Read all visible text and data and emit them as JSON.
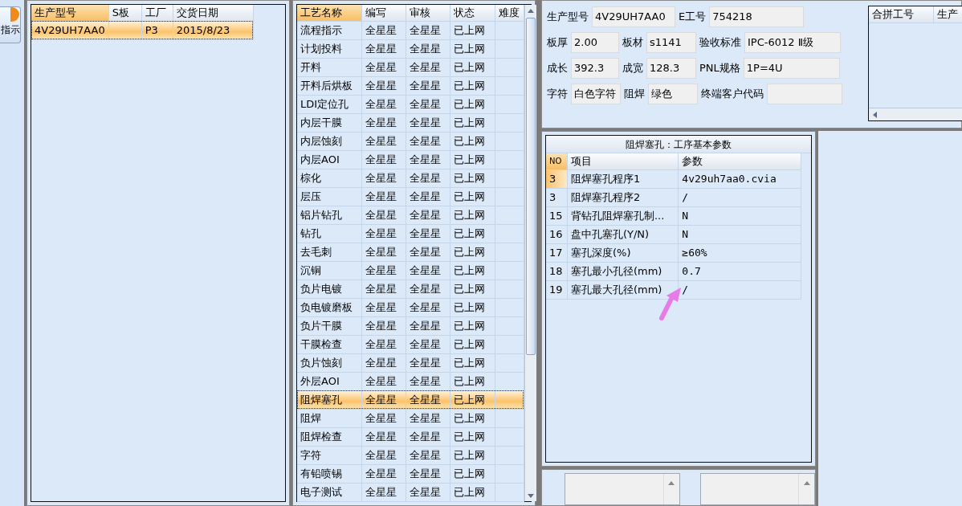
{
  "side_button": {
    "label": "指示"
  },
  "order_table": {
    "columns": [
      "生产型号",
      "S板",
      "工厂",
      "交货日期"
    ],
    "rows": [
      {
        "cells": [
          "4V29UH7AA0",
          "",
          "P3",
          "2015/8/23"
        ],
        "selected": true
      }
    ]
  },
  "process_table": {
    "columns": [
      "工艺名称",
      "编写",
      "审核",
      "状态",
      "难度"
    ],
    "rows": [
      {
        "name": "流程指示",
        "writer": "全星星",
        "reviewer": "全星星",
        "status": "已上网",
        "selected": false
      },
      {
        "name": "计划投料",
        "writer": "全星星",
        "reviewer": "全星星",
        "status": "已上网",
        "selected": false
      },
      {
        "name": "开料",
        "writer": "全星星",
        "reviewer": "全星星",
        "status": "已上网",
        "selected": false
      },
      {
        "name": "开料后烘板",
        "writer": "全星星",
        "reviewer": "全星星",
        "status": "已上网",
        "selected": false
      },
      {
        "name": "LDI定位孔",
        "writer": "全星星",
        "reviewer": "全星星",
        "status": "已上网",
        "selected": false
      },
      {
        "name": "内层干膜",
        "writer": "全星星",
        "reviewer": "全星星",
        "status": "已上网",
        "selected": false
      },
      {
        "name": "内层蚀刻",
        "writer": "全星星",
        "reviewer": "全星星",
        "status": "已上网",
        "selected": false
      },
      {
        "name": "内层AOI",
        "writer": "全星星",
        "reviewer": "全星星",
        "status": "已上网",
        "selected": false
      },
      {
        "name": "棕化",
        "writer": "全星星",
        "reviewer": "全星星",
        "status": "已上网",
        "selected": false
      },
      {
        "name": "层压",
        "writer": "全星星",
        "reviewer": "全星星",
        "status": "已上网",
        "selected": false
      },
      {
        "name": "铝片钻孔",
        "writer": "全星星",
        "reviewer": "全星星",
        "status": "已上网",
        "selected": false
      },
      {
        "name": "钻孔",
        "writer": "全星星",
        "reviewer": "全星星",
        "status": "已上网",
        "selected": false
      },
      {
        "name": "去毛刺",
        "writer": "全星星",
        "reviewer": "全星星",
        "status": "已上网",
        "selected": false
      },
      {
        "name": "沉铜",
        "writer": "全星星",
        "reviewer": "全星星",
        "status": "已上网",
        "selected": false
      },
      {
        "name": "负片电镀",
        "writer": "全星星",
        "reviewer": "全星星",
        "status": "已上网",
        "selected": false
      },
      {
        "name": "负电镀磨板",
        "writer": "全星星",
        "reviewer": "全星星",
        "status": "已上网",
        "selected": false
      },
      {
        "name": "负片干膜",
        "writer": "全星星",
        "reviewer": "全星星",
        "status": "已上网",
        "selected": false
      },
      {
        "name": "干膜检查",
        "writer": "全星星",
        "reviewer": "全星星",
        "status": "已上网",
        "selected": false
      },
      {
        "name": "负片蚀刻",
        "writer": "全星星",
        "reviewer": "全星星",
        "status": "已上网",
        "selected": false
      },
      {
        "name": "外层AOI",
        "writer": "全星星",
        "reviewer": "全星星",
        "status": "已上网",
        "selected": false
      },
      {
        "name": "阻焊塞孔",
        "writer": "全星星",
        "reviewer": "全星星",
        "status": "已上网",
        "selected": true
      },
      {
        "name": "阻焊",
        "writer": "全星星",
        "reviewer": "全星星",
        "status": "已上网",
        "selected": false
      },
      {
        "name": "阻焊检查",
        "writer": "全星星",
        "reviewer": "全星星",
        "status": "已上网",
        "selected": false
      },
      {
        "name": "字符",
        "writer": "全星星",
        "reviewer": "全星星",
        "status": "已上网",
        "selected": false
      },
      {
        "name": "有铅喷锡",
        "writer": "全星星",
        "reviewer": "全星星",
        "status": "已上网",
        "selected": false
      },
      {
        "name": "电子测试",
        "writer": "全星星",
        "reviewer": "全星星",
        "status": "已上网",
        "selected": false
      }
    ]
  },
  "info_form": {
    "rows": [
      [
        {
          "label": "生产型号",
          "value": "4V29UH7AA0"
        },
        null,
        {
          "label": "E工号",
          "value": "754218"
        }
      ],
      [
        {
          "label": "板厚",
          "value": "2.00"
        },
        {
          "label": "板材",
          "value": "s1141"
        },
        {
          "label": "验收标准",
          "value": "IPC-6012 Ⅱ级"
        }
      ],
      [
        {
          "label": "成长",
          "value": "392.3"
        },
        {
          "label": "成宽",
          "value": "128.3"
        },
        {
          "label": "PNL规格",
          "value": "1P=4U"
        }
      ],
      [
        {
          "label": "字符",
          "value": "白色字符"
        },
        {
          "label": "阻焊",
          "value": "绿色"
        },
        {
          "label": "终端客户代码"
        }
      ]
    ]
  },
  "merge_table": {
    "columns": [
      "合拼工号",
      "生产"
    ]
  },
  "param_panel": {
    "title": "阻焊塞孔：工序基本参数",
    "columns": [
      "NO",
      "项目",
      "参数"
    ],
    "rows": [
      {
        "no": "3",
        "item": "阻焊塞孔程序1",
        "value": "4v29uh7aa0.cvia",
        "selected": true
      },
      {
        "no": "3",
        "item": "阻焊塞孔程序2",
        "value": "/",
        "selected": false
      },
      {
        "no": "15",
        "item": "背钻孔阻焊塞孔制...",
        "value": "N",
        "selected": false
      },
      {
        "no": "16",
        "item": "盘中孔塞孔(Y/N)",
        "value": "N",
        "selected": false
      },
      {
        "no": "17",
        "item": "塞孔深度(%)",
        "value": "≥60%",
        "selected": false
      },
      {
        "no": "18",
        "item": "塞孔最小孔径(mm)",
        "value": "0.7",
        "selected": false
      },
      {
        "no": "19",
        "item": "塞孔最大孔径(mm)",
        "value": "/",
        "selected": false
      }
    ]
  }
}
